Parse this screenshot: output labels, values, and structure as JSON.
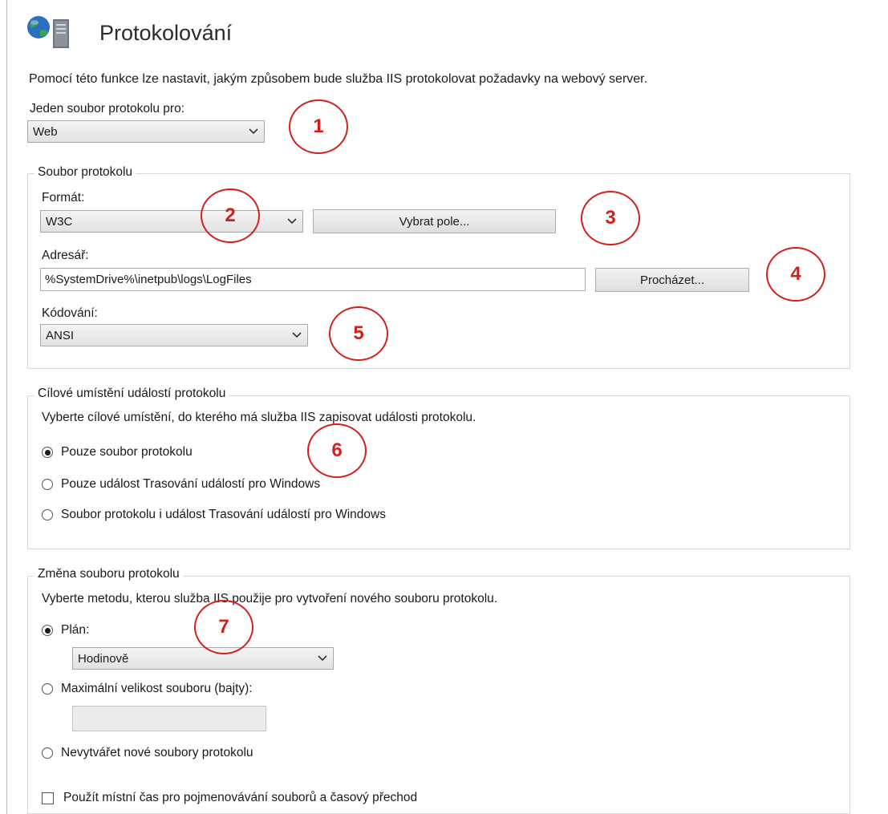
{
  "header": {
    "title": "Protokolování",
    "description": "Pomocí této funkce lze nastavit, jakým způsobem bude služba IIS protokolovat požadavky na webový server.",
    "icon": "iis-server-globe-icon"
  },
  "one_log_file": {
    "label": "Jeden soubor protokolu pro:",
    "value": "Web"
  },
  "log_file": {
    "legend": "Soubor protokolu",
    "format_label": "Formát:",
    "format_value": "W3C",
    "select_fields_button": "Vybrat pole...",
    "directory_label": "Adresář:",
    "directory_value": "%SystemDrive%\\inetpub\\logs\\LogFiles",
    "browse_button": "Procházet...",
    "encoding_label": "Kódování:",
    "encoding_value": "ANSI"
  },
  "event_destination": {
    "legend": "Cílové umístění událostí protokolu",
    "description": "Vyberte cílové umístění, do kterého má služba IIS zapisovat události protokolu.",
    "options": [
      {
        "label": "Pouze soubor protokolu",
        "checked": true
      },
      {
        "label": "Pouze událost Trasování událostí pro Windows",
        "checked": false
      },
      {
        "label": "Soubor protokolu i událost Trasování událostí pro Windows",
        "checked": false
      }
    ]
  },
  "rollover": {
    "legend": "Změna souboru protokolu",
    "description": "Vyberte metodu, kterou služba IIS použije pro vytvoření nového souboru protokolu.",
    "schedule_label": "Plán:",
    "schedule_checked": true,
    "schedule_value": "Hodinově",
    "max_size_label": "Maximální velikost souboru (bajty):",
    "max_size_checked": false,
    "max_size_value": "",
    "no_new_label": "Nevytvářet nové soubory protokolu",
    "no_new_checked": false,
    "local_time_label": "Použít místní čas pro pojmenovávání souborů a časový přechod",
    "local_time_checked": false
  },
  "annotations": [
    "1",
    "2",
    "3",
    "4",
    "5",
    "6",
    "7"
  ],
  "colors": {
    "annotation": "#d41f1f"
  }
}
